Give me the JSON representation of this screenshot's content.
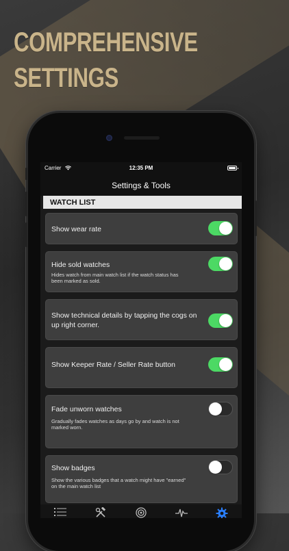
{
  "promo": {
    "headline_line1": "COMPREHENSIVE",
    "headline_line2": "SETTINGS"
  },
  "status_bar": {
    "carrier": "Carrier",
    "time": "12:35 PM"
  },
  "nav": {
    "title": "Settings & Tools"
  },
  "section": {
    "title": "WATCH LIST"
  },
  "settings": [
    {
      "title": "Show wear rate",
      "description": "",
      "enabled": true
    },
    {
      "title": "Hide sold watches",
      "description": "Hides watch from main watch list if the watch status has been marked as sold.",
      "enabled": true
    },
    {
      "title": "Show technical details by tapping the cogs on up right corner.",
      "description": "",
      "enabled": true
    },
    {
      "title": "Show Keeper Rate / Seller Rate button",
      "description": "",
      "enabled": true
    },
    {
      "title": "Fade unworn watches",
      "description": "Gradually fades watches as days go by and watch is not marked worn.",
      "enabled": false
    },
    {
      "title": "Show badges",
      "description": "Show the various badges that a watch might have \"earned\" on the main watch list",
      "enabled": false
    }
  ],
  "tabs": [
    {
      "icon": "list-icon",
      "active": false
    },
    {
      "icon": "tools-icon",
      "active": false
    },
    {
      "icon": "target-icon",
      "active": false
    },
    {
      "icon": "pulse-icon",
      "active": false
    },
    {
      "icon": "gear-icon",
      "active": true
    }
  ],
  "colors": {
    "headline": "#c9b48a",
    "toggle_on": "#4cd964",
    "tab_active": "#2a7fff",
    "tab_inactive": "#bdbdbd"
  }
}
